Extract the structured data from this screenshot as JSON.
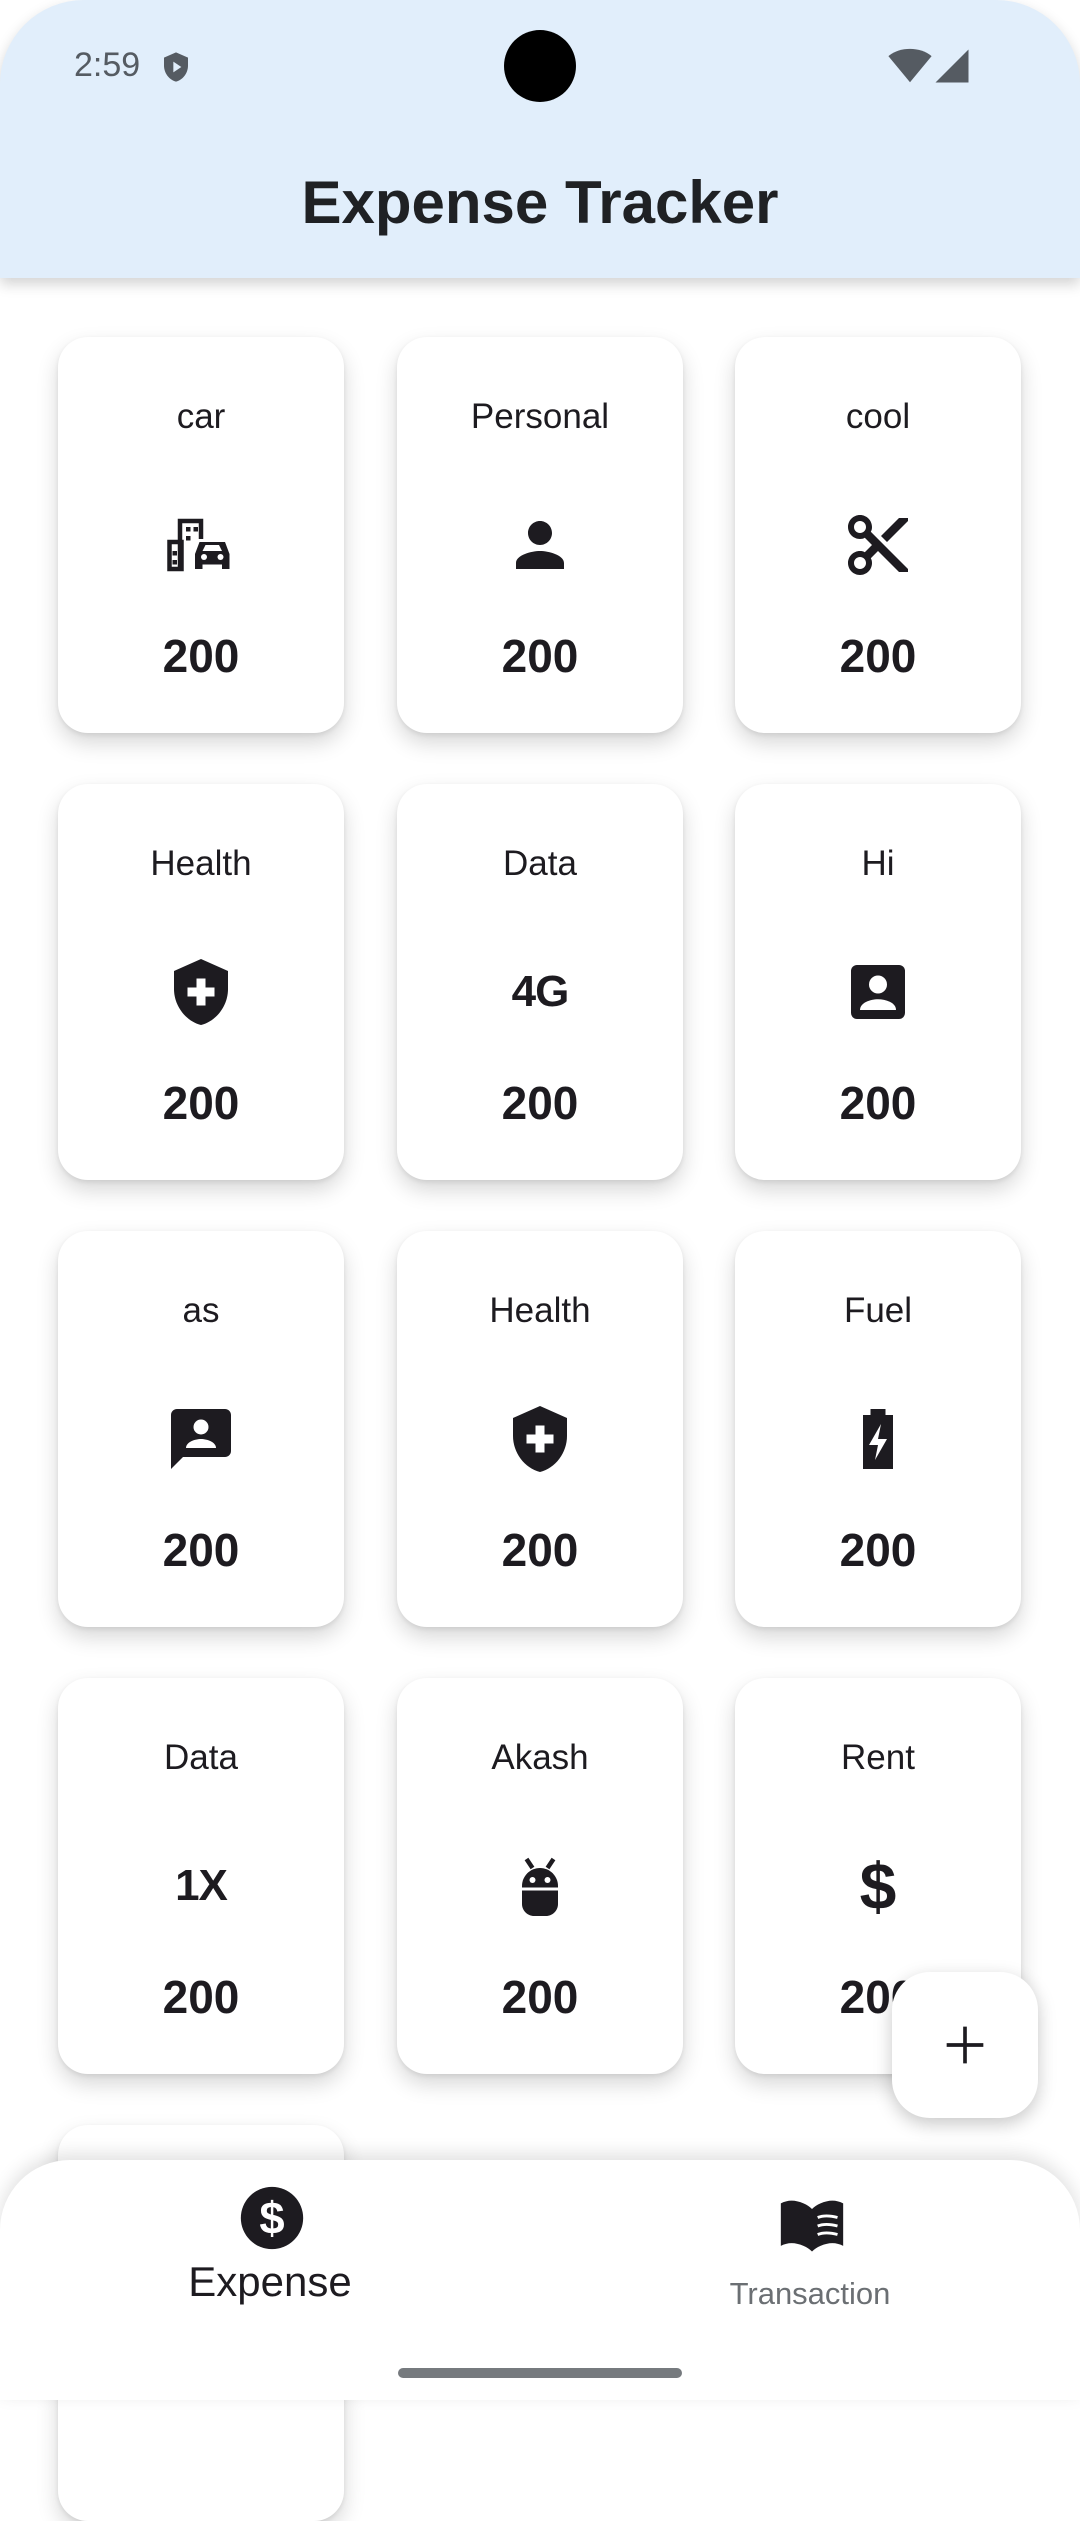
{
  "status_bar": {
    "time": "2:59"
  },
  "app_bar": {
    "title": "Expense Tracker"
  },
  "categories": [
    {
      "label": "car",
      "icon": "car-building-icon",
      "amount": "200"
    },
    {
      "label": "Personal",
      "icon": "person-icon",
      "amount": "200"
    },
    {
      "label": "cool",
      "icon": "scissors-icon",
      "amount": "200"
    },
    {
      "label": "Health",
      "icon": "health-shield-icon",
      "amount": "200"
    },
    {
      "label": "Data",
      "icon": "4g-icon",
      "icon_text": "4G",
      "amount": "200"
    },
    {
      "label": "Hi",
      "icon": "contact-card-icon",
      "amount": "200"
    },
    {
      "label": "as",
      "icon": "contact-message-icon",
      "amount": "200"
    },
    {
      "label": "Health",
      "icon": "health-shield-icon",
      "amount": "200"
    },
    {
      "label": "Fuel",
      "icon": "battery-charging-icon",
      "amount": "200"
    },
    {
      "label": "Data",
      "icon": "1x-icon",
      "icon_text": "1X",
      "amount": "200"
    },
    {
      "label": "Akash",
      "icon": "android-icon",
      "amount": "200"
    },
    {
      "label": "Rent",
      "icon": "dollar-icon",
      "icon_text": "$",
      "amount": "200"
    }
  ],
  "fab": {
    "icon": "plus-icon"
  },
  "bottom_nav": {
    "items": [
      {
        "label": "Expense",
        "icon": "dollar-circle-icon",
        "selected": true
      },
      {
        "label": "Transaction",
        "icon": "book-icon",
        "selected": false
      }
    ]
  },
  "colors": {
    "app_bar_bg": "#e1eefb",
    "card_bg": "#ffffff",
    "text_primary": "#1d1b20",
    "nav_inactive": "#6b6f73"
  }
}
